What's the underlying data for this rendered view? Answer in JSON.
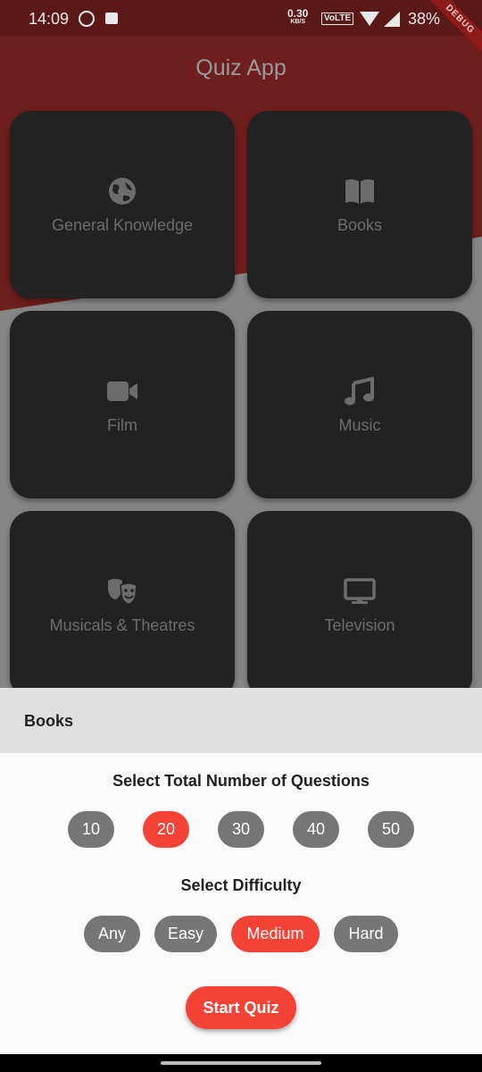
{
  "status_bar": {
    "time": "14:09",
    "net_speed": "0.30",
    "net_unit": "KB/S",
    "volte": "VoLTE",
    "battery": "38%"
  },
  "debug_banner": "DEBUG",
  "app": {
    "title": "Quiz App"
  },
  "categories": [
    {
      "label": "General Knowledge",
      "icon": "globe-icon"
    },
    {
      "label": "Books",
      "icon": "book-icon"
    },
    {
      "label": "Film",
      "icon": "video-camera-icon"
    },
    {
      "label": "Music",
      "icon": "music-note-icon"
    },
    {
      "label": "Musicals & Theatres",
      "icon": "theater-masks-icon"
    },
    {
      "label": "Television",
      "icon": "tv-icon"
    }
  ],
  "sheet": {
    "title": "Books",
    "questions_title": "Select Total Number of Questions",
    "question_counts": [
      "10",
      "20",
      "30",
      "40",
      "50"
    ],
    "selected_count": "20",
    "difficulty_title": "Select Difficulty",
    "difficulties": [
      "Any",
      "Easy",
      "Medium",
      "Hard"
    ],
    "selected_difficulty": "Medium",
    "start_label": "Start Quiz"
  },
  "colors": {
    "accent": "#f44336",
    "pill": "#767676",
    "card": "#222222"
  }
}
